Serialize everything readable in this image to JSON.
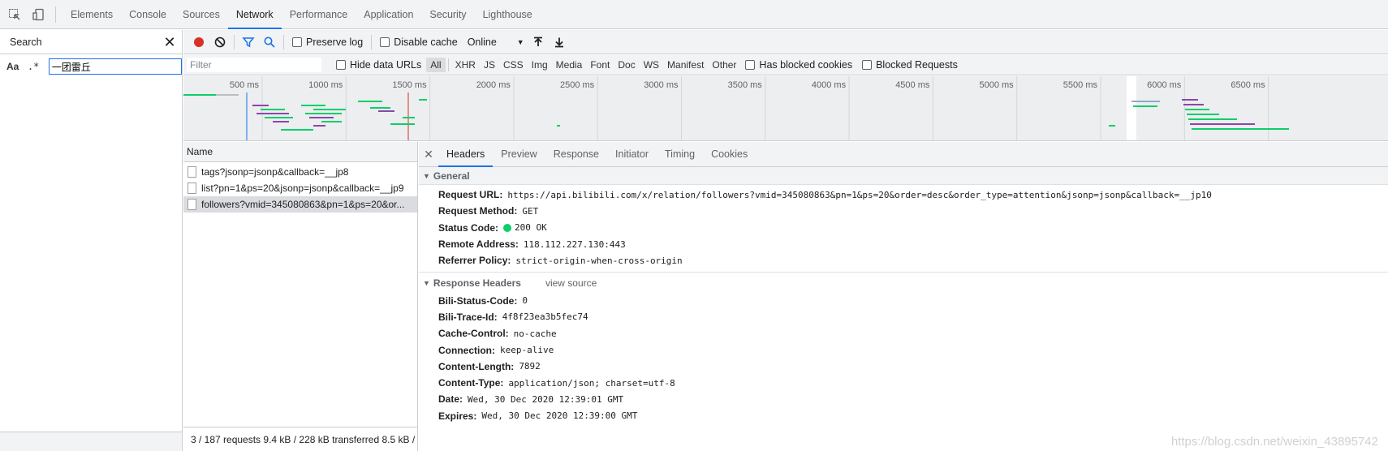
{
  "topbar": {
    "tabs": [
      "Elements",
      "Console",
      "Sources",
      "Network",
      "Performance",
      "Application",
      "Security",
      "Lighthouse"
    ],
    "active_tab": "Network"
  },
  "search": {
    "title": "Search",
    "case_option": "Aa",
    "regex_option": ".*",
    "query": "一团雷丘"
  },
  "toolbar": {
    "preserve_log": "Preserve log",
    "disable_cache": "Disable cache",
    "throttle": "Online"
  },
  "filter": {
    "placeholder": "Filter",
    "hide_data_urls": "Hide data URLs",
    "types": [
      "All",
      "XHR",
      "JS",
      "CSS",
      "Img",
      "Media",
      "Font",
      "Doc",
      "WS",
      "Manifest",
      "Other"
    ],
    "has_blocked_cookies": "Has blocked cookies",
    "blocked_requests": "Blocked Requests"
  },
  "overview": {
    "ticks": [
      "500 ms",
      "1000 ms",
      "1500 ms",
      "2000 ms",
      "2500 ms",
      "3000 ms",
      "3500 ms",
      "4000 ms",
      "4500 ms",
      "5000 ms",
      "5500 ms",
      "6000 ms",
      "6500 ms"
    ]
  },
  "requests": {
    "header": "Name",
    "rows": [
      "tags?jsonp=jsonp&callback=__jp8",
      "list?pn=1&ps=20&jsonp=jsonp&callback=__jp9",
      "followers?vmid=345080863&pn=1&ps=20&or..."
    ],
    "status": "3 / 187 requests  9.4 kB / 228 kB transferred  8.5 kB /"
  },
  "details": {
    "tabs": [
      "Headers",
      "Preview",
      "Response",
      "Initiator",
      "Timing",
      "Cookies"
    ],
    "active_tab": "Headers",
    "general_title": "General",
    "general": [
      {
        "k": "Request URL:",
        "v": "https://api.bilibili.com/x/relation/followers?vmid=345080863&pn=1&ps=20&order=desc&order_type=attention&jsonp=jsonp&callback=__jp10"
      },
      {
        "k": "Request Method:",
        "v": "GET"
      },
      {
        "k": "Status Code:",
        "v": "200 OK"
      },
      {
        "k": "Remote Address:",
        "v": "118.112.227.130:443"
      },
      {
        "k": "Referrer Policy:",
        "v": "strict-origin-when-cross-origin"
      }
    ],
    "response_title": "Response Headers",
    "view_source": "view source",
    "response": [
      {
        "k": "Bili-Status-Code:",
        "v": "0"
      },
      {
        "k": "Bili-Trace-Id:",
        "v": "4f8f23ea3b5fec74"
      },
      {
        "k": "Cache-Control:",
        "v": "no-cache"
      },
      {
        "k": "Connection:",
        "v": "keep-alive"
      },
      {
        "k": "Content-Length:",
        "v": "7892"
      },
      {
        "k": "Content-Type:",
        "v": "application/json; charset=utf-8"
      },
      {
        "k": "Date:",
        "v": "Wed, 30 Dec 2020 12:39:01 GMT"
      },
      {
        "k": "Expires:",
        "v": "Wed, 30 Dec 2020 12:39:00 GMT"
      }
    ]
  },
  "watermark": "https://blog.csdn.net/weixin_43895742",
  "colors": {
    "accent": "#1a73e8",
    "record": "#d93025",
    "status_ok": "#0cce6b"
  }
}
